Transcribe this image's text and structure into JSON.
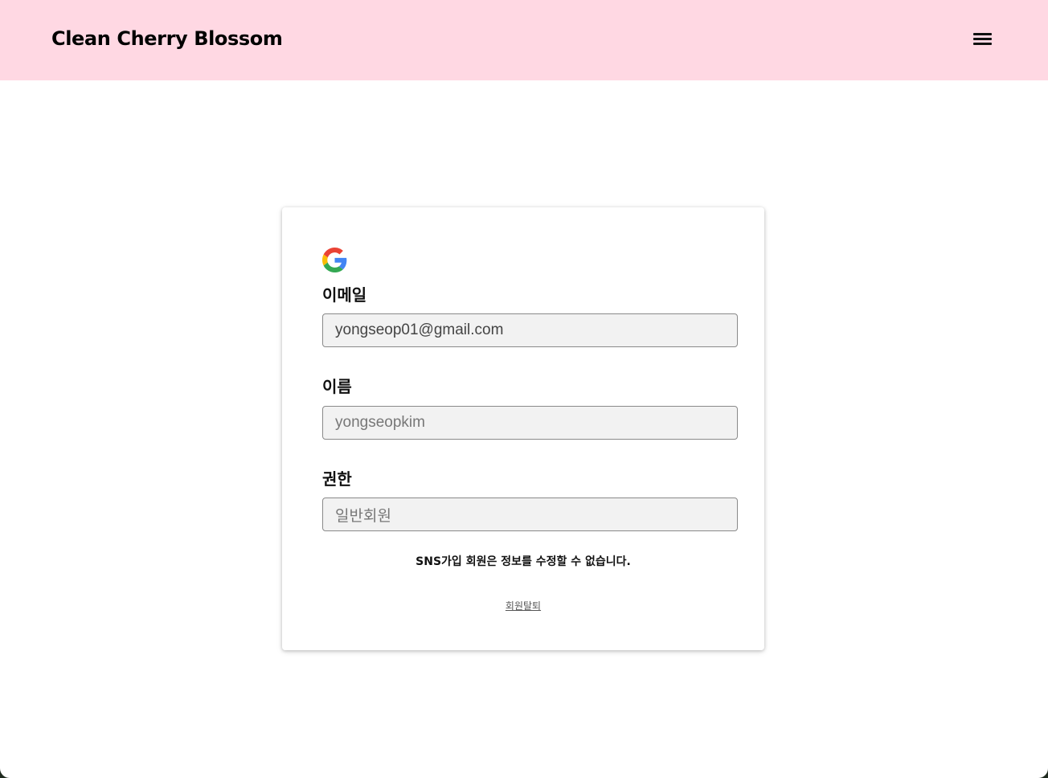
{
  "header": {
    "brand": "Clean Cherry Blossom",
    "menu_icon": "hamburger-menu-icon",
    "background": "#ffd8e3"
  },
  "profile": {
    "provider_icon": "google-logo-icon",
    "fields": [
      {
        "label": "이메일",
        "value": "yongseop01@gmail.com"
      },
      {
        "label": "이름",
        "value": "yongseopkim"
      },
      {
        "label": "권한",
        "value": "일반회원"
      }
    ],
    "notice": "SNS가입 회원은 정보를 수정할 수 없습니다.",
    "withdraw_label": "회원탈퇴"
  }
}
